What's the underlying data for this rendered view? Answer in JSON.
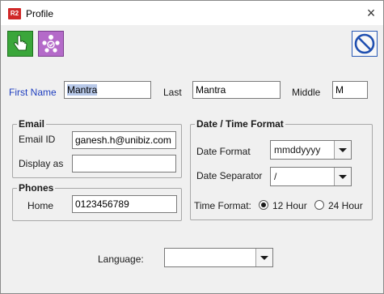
{
  "window": {
    "app_icon_text": "R2",
    "title": "Profile",
    "close_glyph": "×"
  },
  "toolbar": {
    "buttons": [
      {
        "icon": "hand-pointer-icon",
        "color": "#3aa63a"
      },
      {
        "icon": "users-network-icon",
        "color": "#b46ac9"
      },
      {
        "icon": "cancel-icon",
        "color": "#2a5bb5"
      }
    ]
  },
  "name": {
    "first_label": "First Name",
    "first_value": "Mantra",
    "last_label": "Last",
    "last_value": "Mantra",
    "middle_label": "Middle",
    "middle_value": "M"
  },
  "email": {
    "group_title": "Email",
    "id_label": "Email ID",
    "id_value": "ganesh.h@unibiz.com",
    "display_label": "Display as",
    "display_value": ""
  },
  "phones": {
    "group_title": "Phones",
    "home_label": "Home",
    "home_value": "0123456789"
  },
  "datetime": {
    "group_title": "Date / Time Format",
    "date_format_label": "Date Format",
    "date_format_value": "mmddyyyy",
    "date_separator_label": "Date Separator",
    "date_separator_value": "/",
    "time_format_label": "Time Format:",
    "option_12": "12 Hour",
    "option_24": "24 Hour",
    "selected": "12 Hour"
  },
  "language": {
    "label": "Language:",
    "value": ""
  }
}
